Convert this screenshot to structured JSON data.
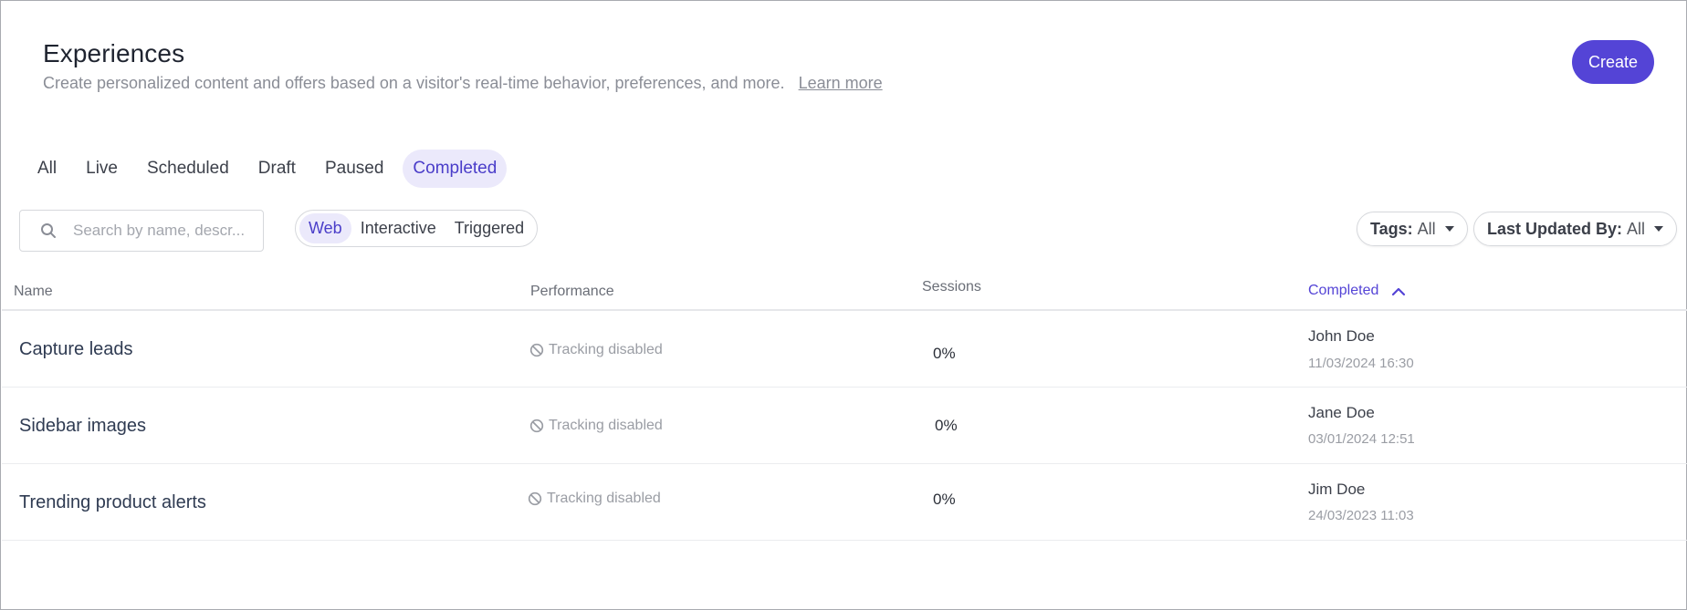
{
  "header": {
    "title": "Experiences",
    "subtitle": "Create personalized content and offers based on a visitor's real-time behavior, preferences, and more.",
    "learn_more": "Learn more",
    "create_label": "Create"
  },
  "status_tabs": [
    {
      "label": "All",
      "active": false
    },
    {
      "label": "Live",
      "active": false
    },
    {
      "label": "Scheduled",
      "active": false
    },
    {
      "label": "Draft",
      "active": false
    },
    {
      "label": "Paused",
      "active": false
    },
    {
      "label": "Completed",
      "active": true
    }
  ],
  "search": {
    "placeholder": "Search by name, descr...",
    "value": "",
    "icon": "search-icon"
  },
  "type_filter": [
    {
      "label": "Web",
      "active": true
    },
    {
      "label": "Interactive",
      "active": false
    },
    {
      "label": "Triggered",
      "active": false
    }
  ],
  "filters": {
    "tags_label": "Tags:",
    "tags_value": "All",
    "last_updated_label": "Last Updated By:",
    "last_updated_value": "All"
  },
  "table": {
    "columns": {
      "name": "Name",
      "performance": "Performance",
      "sessions": "Sessions",
      "completed": "Completed"
    },
    "sort": {
      "column": "completed",
      "direction": "ascending",
      "icon": "chevron-up-icon"
    },
    "rows": [
      {
        "name": "Capture leads",
        "performance": "Tracking disabled",
        "sessions": "0%",
        "user": "John Doe",
        "date": "11/03/2024 16:30"
      },
      {
        "name": "Sidebar images",
        "performance": "Tracking disabled",
        "sessions": "0%",
        "user": "Jane Doe",
        "date": "03/01/2024 12:51"
      },
      {
        "name": "Trending product alerts",
        "performance": "Tracking disabled",
        "sessions": "0%",
        "user": "Jim Doe",
        "date": "24/03/2023 11:03"
      }
    ]
  },
  "colors": {
    "accent": "#5444d6",
    "accent_soft": "#ebe9fb",
    "muted_text": "#9a9da4"
  }
}
